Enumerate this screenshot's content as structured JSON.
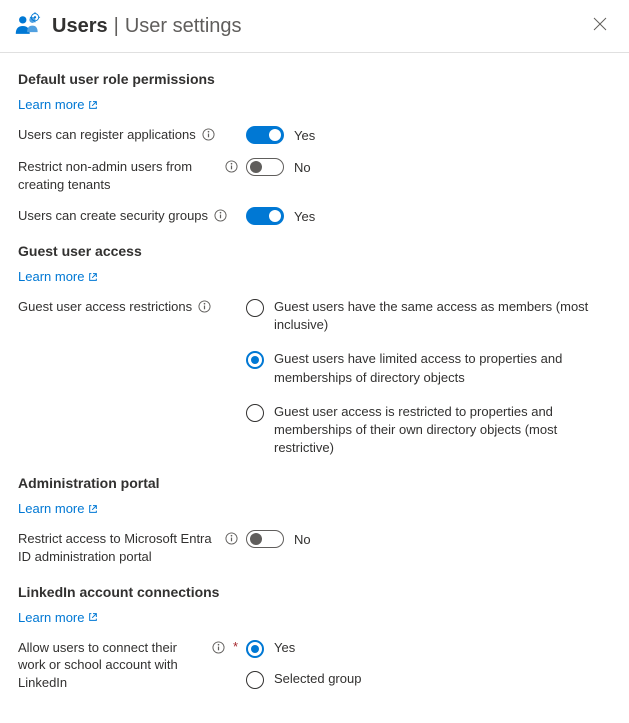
{
  "header": {
    "title": "Users",
    "divider": "|",
    "subtitle": "User settings"
  },
  "links": {
    "learn_more": "Learn more"
  },
  "toggle_labels": {
    "yes": "Yes",
    "no": "No"
  },
  "sections": {
    "default_permissions": {
      "title": "Default user role permissions",
      "register_apps_label": "Users can register applications",
      "restrict_tenants_label": "Restrict non-admin users from creating tenants",
      "security_groups_label": "Users can create security groups"
    },
    "guest_access": {
      "title": "Guest user access",
      "restrictions_label": "Guest user access restrictions",
      "options": {
        "same": "Guest users have the same access as members (most inclusive)",
        "limited": "Guest users have limited access to properties and memberships of directory objects",
        "restricted": "Guest user access is restricted to properties and memberships of their own directory objects (most restrictive)"
      }
    },
    "admin_portal": {
      "title": "Administration portal",
      "restrict_label": "Restrict access to Microsoft Entra ID administration portal"
    },
    "linkedin": {
      "title": "LinkedIn account connections",
      "allow_label": "Allow users to connect their work or school account with LinkedIn",
      "options": {
        "yes": "Yes",
        "selected_group": "Selected group"
      }
    }
  }
}
